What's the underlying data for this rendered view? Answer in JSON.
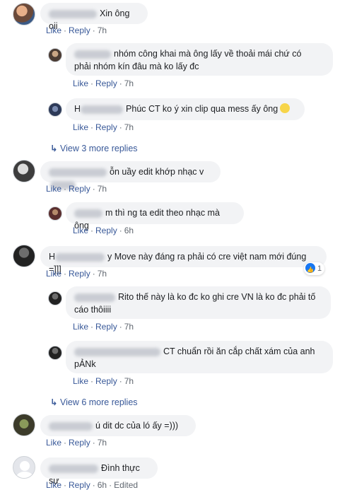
{
  "comments": [
    {
      "id": "c1",
      "text": "Xin ông oii",
      "like": "Like",
      "reply": "Reply",
      "time": "7h"
    },
    {
      "id": "r1",
      "text": "nhóm công khai mà ông lấy về thoải mái chứ có",
      "text2": "phải nhóm kín đâu mà ko lấy đc",
      "like": "Like",
      "reply": "Reply",
      "time": "7h"
    },
    {
      "id": "r2",
      "name_visible": "H",
      "text": "Phúc CT ko ý xin clip qua mess ấy ông",
      "like": "Like",
      "reply": "Reply",
      "time": "7h"
    },
    {
      "id": "v1",
      "text": "View 3 more replies"
    },
    {
      "id": "c2",
      "text": "ỗn uầy edit khớp nhạc v",
      "like": "Like",
      "reply": "Reply",
      "time": "7h"
    },
    {
      "id": "r3",
      "text": "m thì ng ta edit theo nhạc mà ông",
      "like": "Like",
      "reply": "Reply",
      "time": "6h"
    },
    {
      "id": "c3",
      "name_visible": "H",
      "text": "y Move này đáng ra phải có cre việt nam mới đúng =]]]",
      "like": "Like",
      "reply": "Reply",
      "time": "7h",
      "reactions": "1"
    },
    {
      "id": "r4",
      "text": "Rito thế này là ko đc ko ghi cre VN là ko đc phải tố",
      "text2": "cáo thôiiii",
      "like": "Like",
      "reply": "Reply",
      "time": "7h"
    },
    {
      "id": "r5",
      "text": "CT chuẩn rồi ăn cắp chất xám của anh",
      "text2": "pẢNk",
      "like": "Like",
      "reply": "Reply",
      "time": "7h"
    },
    {
      "id": "v2",
      "text": "View 6 more replies"
    },
    {
      "id": "c4",
      "text": "ú dit dc của ló ấy =)))",
      "like": "Like",
      "reply": "Reply",
      "time": "7h"
    },
    {
      "id": "c5",
      "text": "Đình thực sự",
      "like": "Like",
      "reply": "Reply",
      "time": "6h",
      "edited": "Edited"
    }
  ],
  "colors": {
    "link": "#385898",
    "bubble": "#f2f3f5",
    "meta": "#606770",
    "like_blue": "#1877f2"
  }
}
